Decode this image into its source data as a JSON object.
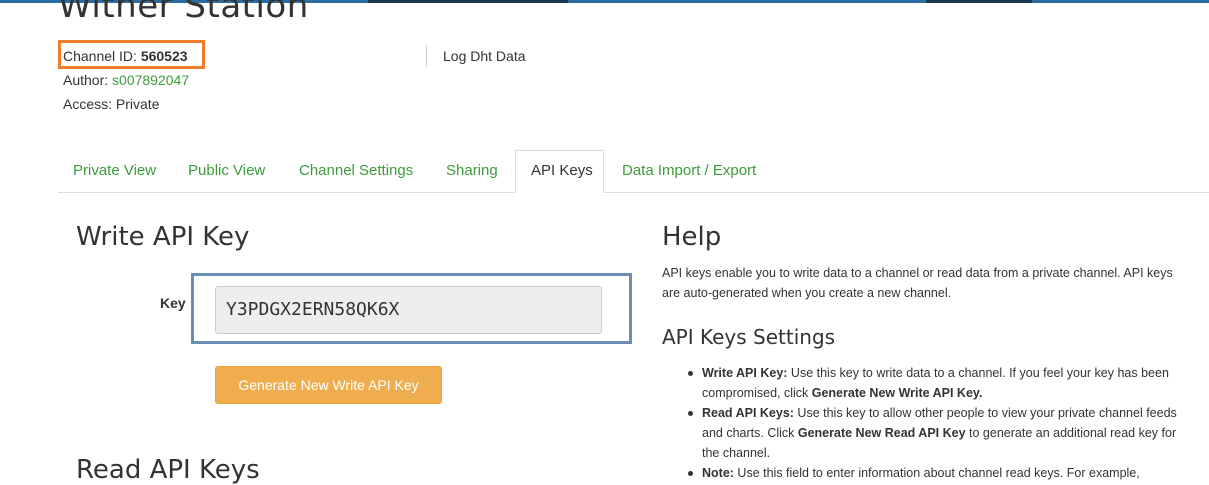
{
  "channel": {
    "title": "Wither Station",
    "id_label": "Channel ID:",
    "id_value": "560523",
    "author_label": "Author:",
    "author_value": "s007892047",
    "access_label": "Access:",
    "access_value": "Private",
    "description": "Log Dht Data"
  },
  "tabs": [
    {
      "label": "Private View"
    },
    {
      "label": "Public View"
    },
    {
      "label": "Channel Settings"
    },
    {
      "label": "Sharing"
    },
    {
      "label": "API Keys",
      "active": true
    },
    {
      "label": "Data Import / Export"
    }
  ],
  "write_key": {
    "heading": "Write API Key",
    "key_label": "Key",
    "key_value": "Y3PDGX2ERN58QK6X",
    "generate_button": "Generate New Write API Key"
  },
  "read_keys": {
    "heading": "Read API Keys"
  },
  "help": {
    "heading": "Help",
    "intro": "API keys enable you to write data to a channel or read data from a private channel. API keys are auto-generated when you create a new channel.",
    "settings_heading": "API Keys Settings",
    "items": [
      {
        "term": "Write API Key:",
        "text_before": " Use this key to write data to a channel. If you feel your key has been compromised, click ",
        "bold": "Generate New Write API Key.",
        "text_after": ""
      },
      {
        "term": "Read API Keys:",
        "text_before": " Use this key to allow other people to view your private channel feeds and charts. Click ",
        "bold": "Generate New Read API Key",
        "text_after": " to generate an additional read key for the channel."
      },
      {
        "term": "Note:",
        "text_before": " Use this field to enter information about channel read keys. For example,",
        "bold": "",
        "text_after": ""
      }
    ]
  },
  "colors": {
    "link_green": "#3c9c3c",
    "highlight_orange": "#ef7d2c",
    "highlight_blue": "#6a8db4",
    "button_orange": "#f0ad4e"
  }
}
